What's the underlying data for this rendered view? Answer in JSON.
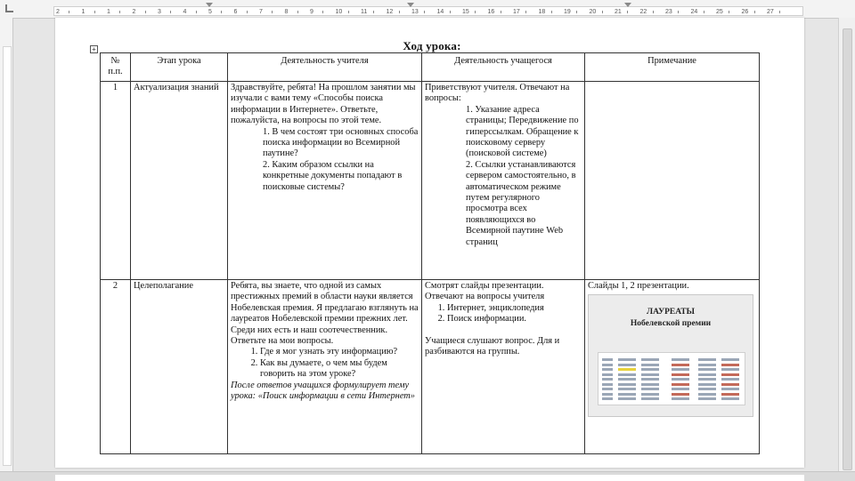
{
  "ruler": {
    "numbers": [
      "2",
      "1",
      "1",
      "2",
      "3",
      "4",
      "5",
      "6",
      "7",
      "8",
      "9",
      "10",
      "11",
      "12",
      "13",
      "14",
      "15",
      "16",
      "17",
      "18",
      "19",
      "20",
      "21",
      "22",
      "23",
      "24",
      "25",
      "26",
      "27"
    ]
  },
  "document": {
    "heading": "Ход урока:",
    "table_anchor_icon": "move-table-icon",
    "columns": [
      "№ п.п.",
      "Этап урока",
      "Деятельность учителя",
      "Деятельность учащегося",
      "Примечание"
    ],
    "rows": [
      {
        "num": "1",
        "stage": "Актуализация знаний",
        "teacher": {
          "intro": "Здравствуйте, ребята! На прошлом занятии мы изучали с вами тему «Способы поиска информации в Интернете». Ответьте, пожалуйста, на вопросы по этой теме.",
          "q1": "1.    В чем состоят три основных способа поиска информации во Всемирной паутине?",
          "q2": "2.    Каким образом ссылки на конкретные документы попадают в поисковые системы?"
        },
        "student": {
          "intro": "Приветствуют учителя. Отвечают на вопросы:",
          "a1": "1.          Указание адреса страницы; Передвижение по гиперссылкам. Обращение к поисковому серверу (поисковой системе)",
          "a2": "2.          Ссылки устанавливаются сервером самостоятельно, в автоматическом режиме путем регулярного просмотра всех появляющихся во Всемирной паутине Web страниц"
        },
        "note": ""
      },
      {
        "num": "2",
        "stage": "Целеполагание",
        "teacher": {
          "intro": "Ребята, вы знаете, что одной из самых престижных премий в области науки является Нобелевская премия. Я предлагаю взглянуть на лауреатов Нобелевской премии прежних лет. Среди них есть и наш соотечественник. Ответьте на мои вопросы.",
          "questions": [
            "Где я мог узнать эту информацию?",
            "Как вы думаете, о чем мы будем говорить на этом уроке?"
          ],
          "outro": "После ответов учащихся формулирует тему урока: «Поиск информации в сети Интернет»"
        },
        "student": {
          "intro": "Смотрят слайды презентации. Отвечают на вопросы учителя",
          "answers": [
            "Интернет, энциклопедия",
            "Поиск информации."
          ],
          "outro": "Учащиеся слушают вопрос. Для и разбиваются на группы."
        },
        "note": {
          "text": "Слайды 1, 2 презентации.",
          "slide_title": "ЛАУРЕАТЫ Нобелевской премии"
        }
      }
    ]
  },
  "colors": {
    "background": "#e6e6e6",
    "page": "#ffffff",
    "border": "#333333"
  }
}
